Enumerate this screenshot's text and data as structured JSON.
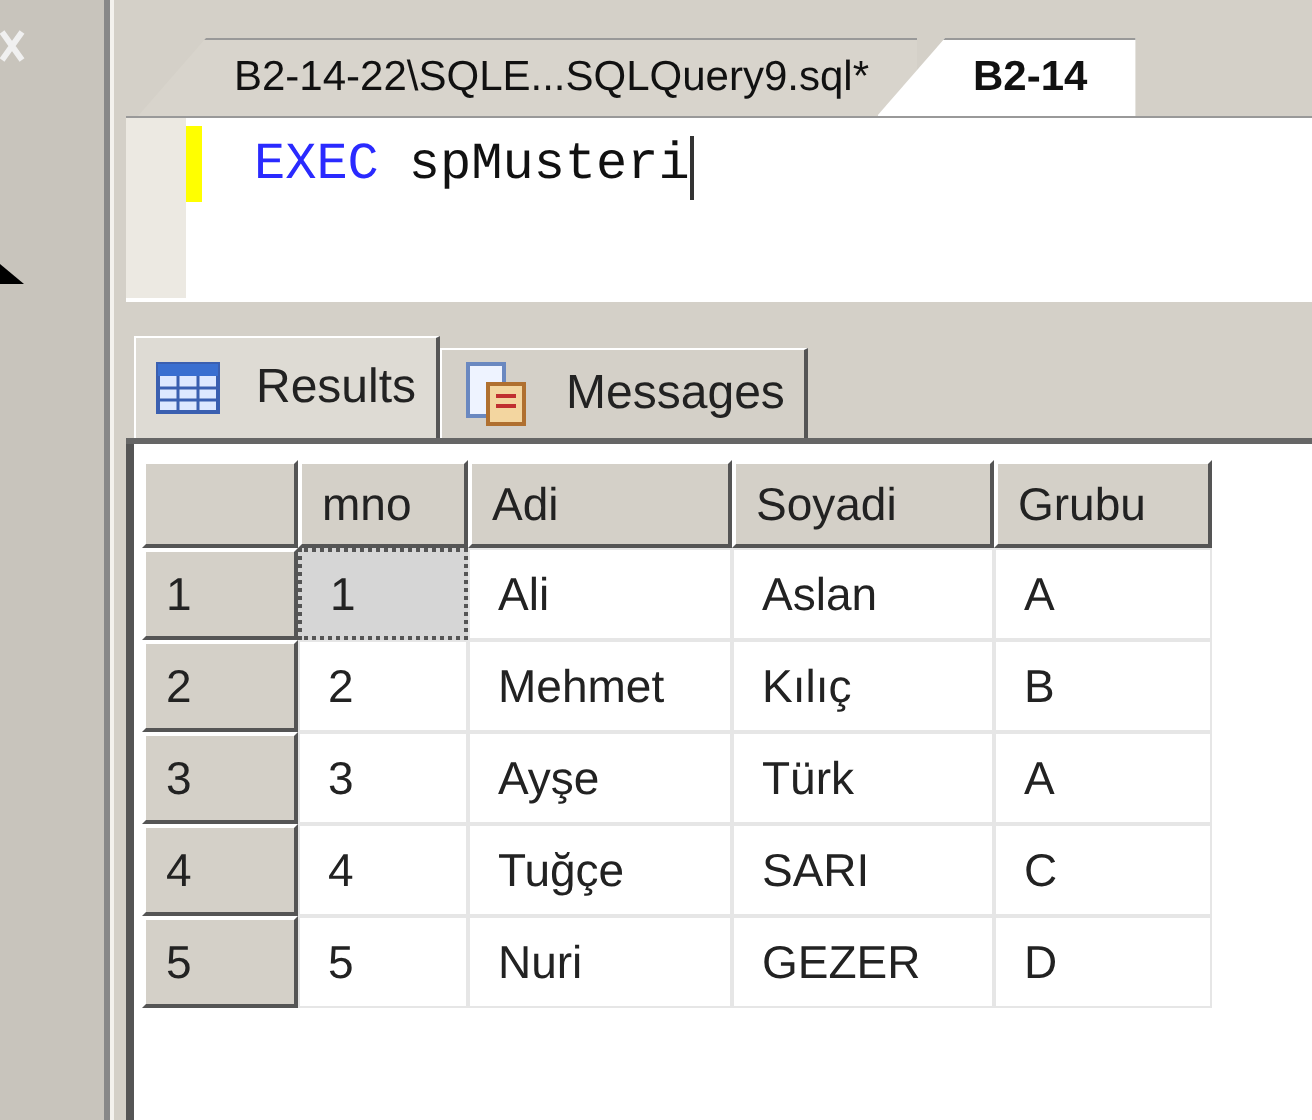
{
  "document_tabs": [
    {
      "label": "B2-14-22\\SQLE...SQLQuery9.sql*",
      "selected": false
    },
    {
      "label": "B2-14",
      "selected": true
    }
  ],
  "editor": {
    "tokens": [
      {
        "kind": "keyword",
        "text": "EXEC"
      },
      {
        "kind": "identifier",
        "text": "spMusteri"
      }
    ]
  },
  "result_tabs": [
    {
      "label": "Results",
      "kind": "grid",
      "selected": true
    },
    {
      "label": "Messages",
      "kind": "messages",
      "selected": false
    }
  ],
  "grid": {
    "columns": [
      "mno",
      "Adi",
      "Soyadi",
      "Grubu"
    ],
    "rows": [
      {
        "number": "1",
        "cells": [
          {
            "text": "1",
            "selected": true
          },
          {
            "text": "Ali",
            "selected": false
          },
          {
            "text": "Aslan",
            "selected": false
          },
          {
            "text": "A",
            "selected": false
          }
        ]
      },
      {
        "number": "2",
        "cells": [
          {
            "text": "2",
            "selected": false
          },
          {
            "text": "Mehmet",
            "selected": false
          },
          {
            "text": "Kılıç",
            "selected": false
          },
          {
            "text": "B",
            "selected": false
          }
        ]
      },
      {
        "number": "3",
        "cells": [
          {
            "text": "3",
            "selected": false
          },
          {
            "text": "Ayşe",
            "selected": false
          },
          {
            "text": "Türk",
            "selected": false
          },
          {
            "text": "A",
            "selected": false
          }
        ]
      },
      {
        "number": "4",
        "cells": [
          {
            "text": "4",
            "selected": false
          },
          {
            "text": "Tuğçe",
            "selected": false
          },
          {
            "text": "SARI",
            "selected": false
          },
          {
            "text": "C",
            "selected": false
          }
        ]
      },
      {
        "number": "5",
        "cells": [
          {
            "text": "5",
            "selected": false
          },
          {
            "text": "Nuri",
            "selected": false
          },
          {
            "text": "GEZER",
            "selected": false
          },
          {
            "text": "D",
            "selected": false
          }
        ]
      }
    ]
  }
}
